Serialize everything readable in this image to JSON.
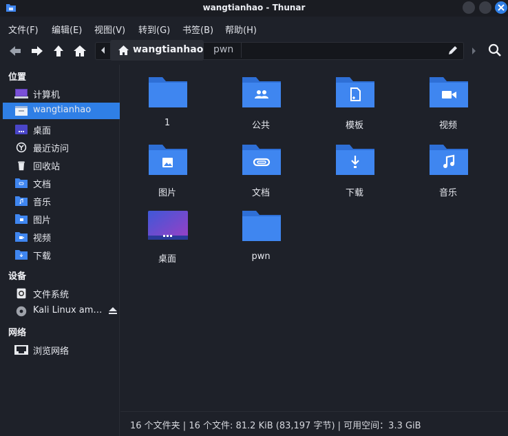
{
  "window": {
    "title": "wangtianhao - Thunar"
  },
  "menu": [
    "文件(F)",
    "编辑(E)",
    "视图(V)",
    "转到(G)",
    "书签(B)",
    "帮助(H)"
  ],
  "location": {
    "current": "wangtianhao",
    "next": "pwn"
  },
  "sidebar": {
    "places_heading": "位置",
    "places": [
      {
        "label": "计算机",
        "icon": "computer-icon"
      },
      {
        "label": "wangtianhao",
        "icon": "home-folder-icon",
        "selected": true
      },
      {
        "label": "桌面",
        "icon": "desktop-icon"
      },
      {
        "label": "最近访问",
        "icon": "recent-icon"
      },
      {
        "label": "回收站",
        "icon": "trash-icon"
      },
      {
        "label": "文档",
        "icon": "documents-folder-icon"
      },
      {
        "label": "音乐",
        "icon": "music-folder-icon"
      },
      {
        "label": "图片",
        "icon": "pictures-folder-icon"
      },
      {
        "label": "视频",
        "icon": "videos-folder-icon"
      },
      {
        "label": "下载",
        "icon": "downloads-folder-icon"
      }
    ],
    "devices_heading": "设备",
    "devices": [
      {
        "label": "文件系统",
        "icon": "drive-icon"
      },
      {
        "label": "Kali Linux am…",
        "icon": "optical-disc-icon"
      }
    ],
    "network_heading": "网络",
    "network": [
      {
        "label": "浏览网络",
        "icon": "network-icon"
      }
    ]
  },
  "files": [
    {
      "name": "1",
      "icon": "folder-icon"
    },
    {
      "name": "公共",
      "icon": "public-folder-icon"
    },
    {
      "name": "模板",
      "icon": "templates-folder-icon"
    },
    {
      "name": "视频",
      "icon": "videos-folder-icon"
    },
    {
      "name": "图片",
      "icon": "pictures-folder-icon"
    },
    {
      "name": "文档",
      "icon": "documents-folder-icon"
    },
    {
      "name": "下载",
      "icon": "downloads-folder-icon"
    },
    {
      "name": "音乐",
      "icon": "music-folder-icon"
    },
    {
      "name": "桌面",
      "icon": "desktop-folder-icon"
    },
    {
      "name": "pwn",
      "icon": "folder-icon"
    }
  ],
  "status": "16 个文件夹 | 16 个文件: 81.2 KiB (83,197 字节) | 可用空间：3.3 GiB",
  "colors": {
    "accent": "#2f7fe6",
    "folder": "#3f86f0",
    "background": "#1e2129"
  }
}
